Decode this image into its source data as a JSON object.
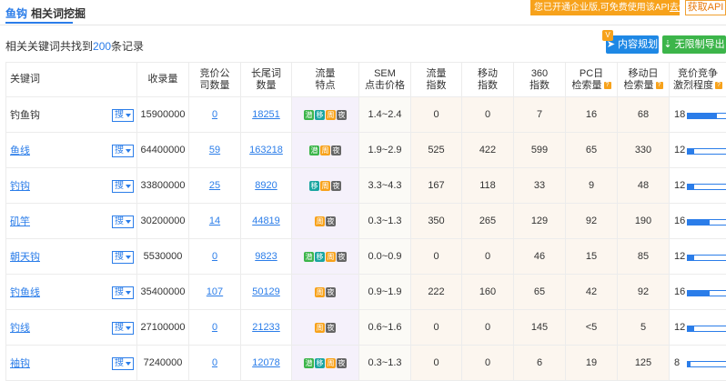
{
  "tabs": {
    "active": "鱼钩",
    "second": "相关词挖掘"
  },
  "banner": {
    "text": "您已开通企业版,可免费使用该API",
    "link": "去使用"
  },
  "api_button": "获取API",
  "summary": {
    "prefix": "相关关键词共找到",
    "count": "200",
    "suffix": "条记录"
  },
  "buttons": {
    "plan": "内容规划",
    "plan_badge": "V",
    "export": "无限制导出"
  },
  "headers": {
    "kw": "关键词",
    "shoulu": "收录量",
    "jingjia1": "竞价公",
    "jingjia2": "司数量",
    "chang1": "长尾词",
    "chang2": "数量",
    "feat1": "流量",
    "feat2": "特点",
    "sem1": "SEM",
    "sem2": "点击价格",
    "flow1": "流量",
    "flow2": "指数",
    "mob1": "移动",
    "mob2": "指数",
    "s3601": "360",
    "s3602": "指数",
    "pc1": "PC日",
    "pc2": "检索量",
    "md1": "移动日",
    "md2": "检索量",
    "comp1": "竞价竞争",
    "comp2": "激烈程度",
    "q": "?"
  },
  "sou_label": "搜",
  "rows": [
    {
      "kw": "钓鱼钩",
      "kw_link": false,
      "shoulu": "15900000",
      "jingjia": "0",
      "chang": "18251",
      "tags": [
        "潜",
        "移",
        "周",
        "夜"
      ],
      "sem": "1.4~2.4",
      "flow": "0",
      "mob": "0",
      "s360": "7",
      "pc": "16",
      "md": "68",
      "comp": "18",
      "comp_pct": 0.55
    },
    {
      "kw": "鱼线",
      "kw_link": true,
      "shoulu": "64400000",
      "jingjia": "59",
      "chang": "163218",
      "tags": [
        "潜",
        "周",
        "夜"
      ],
      "sem": "1.9~2.9",
      "flow": "525",
      "mob": "422",
      "s360": "599",
      "pc": "65",
      "md": "330",
      "comp": "12",
      "comp_pct": 0.12
    },
    {
      "kw": "钓钩",
      "kw_link": true,
      "shoulu": "33800000",
      "jingjia": "25",
      "chang": "8920",
      "tags": [
        "移",
        "周",
        "夜"
      ],
      "sem": "3.3~4.3",
      "flow": "167",
      "mob": "118",
      "s360": "33",
      "pc": "9",
      "md": "48",
      "comp": "12",
      "comp_pct": 0.12
    },
    {
      "kw": "矶竿",
      "kw_link": true,
      "shoulu": "30200000",
      "jingjia": "14",
      "chang": "44819",
      "tags": [
        "周",
        "夜"
      ],
      "sem": "0.3~1.3",
      "flow": "350",
      "mob": "265",
      "s360": "129",
      "pc": "92",
      "md": "190",
      "comp": "16",
      "comp_pct": 0.42
    },
    {
      "kw": "朝天钩",
      "kw_link": true,
      "shoulu": "5530000",
      "jingjia": "0",
      "chang": "9823",
      "tags": [
        "潜",
        "移",
        "周",
        "夜"
      ],
      "sem": "0.0~0.9",
      "flow": "0",
      "mob": "0",
      "s360": "46",
      "pc": "15",
      "md": "85",
      "comp": "12",
      "comp_pct": 0.12
    },
    {
      "kw": "钓鱼线",
      "kw_link": true,
      "shoulu": "35400000",
      "jingjia": "107",
      "chang": "50129",
      "tags": [
        "周",
        "夜"
      ],
      "sem": "0.9~1.9",
      "flow": "222",
      "mob": "160",
      "s360": "65",
      "pc": "42",
      "md": "92",
      "comp": "16",
      "comp_pct": 0.42
    },
    {
      "kw": "钓线",
      "kw_link": true,
      "shoulu": "27100000",
      "jingjia": "0",
      "chang": "21233",
      "tags": [
        "周",
        "夜"
      ],
      "sem": "0.6~1.6",
      "flow": "0",
      "mob": "0",
      "s360": "145",
      "pc": "<5",
      "md": "5",
      "comp": "12",
      "comp_pct": 0.12
    },
    {
      "kw": "袖钩",
      "kw_link": true,
      "shoulu": "7240000",
      "jingjia": "0",
      "chang": "12078",
      "tags": [
        "潜",
        "移",
        "周",
        "夜"
      ],
      "sem": "0.3~1.3",
      "flow": "0",
      "mob": "0",
      "s360": "6",
      "pc": "19",
      "md": "125",
      "comp": "8",
      "comp_pct": 0.05
    }
  ]
}
